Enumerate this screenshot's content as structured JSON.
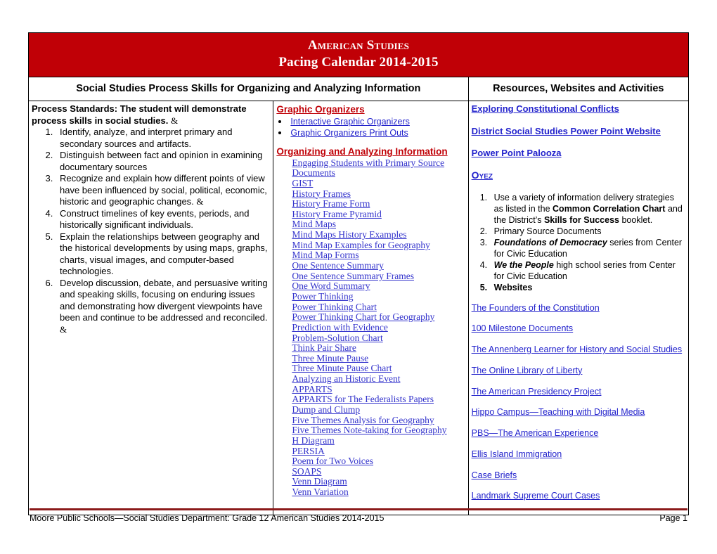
{
  "banner": {
    "title": "American Studies",
    "subtitle": "Pacing Calendar 2014-2015"
  },
  "columns": {
    "left_header": "Social Studies Process Skills for Organizing and Analyzing Information",
    "right_header": "Resources, Websites and Activities"
  },
  "left_column": {
    "intro_bold": "Process Standards: The student will demonstrate process skills in social studies.",
    "intro_amp": "&",
    "standards": [
      "Identify, analyze, and interpret primary and secondary sources and artifacts.",
      "Distinguish between fact and opinion in examining documentary sources",
      "Recognize and explain how different points of view have been influenced by social, political, economic, historic and geographic changes. &",
      "Construct timelines of key events, periods, and historically significant individuals.",
      "Explain the relationships between geography and the historical developments by using maps, graphs, charts, visual images, and computer-based technologies.",
      "Develop discussion, debate, and persuasive writing and speaking skills, focusing on enduring issues and demonstrating how divergent viewpoints have been and continue to be addressed and reconciled. &"
    ]
  },
  "middle_column": {
    "section1_heading": "Graphic Organizers",
    "section1_links": [
      "Interactive Graphic Organizers",
      "Graphic Organizers Print Outs"
    ],
    "section2_heading": "Organizing and Analyzing Information",
    "section2_links": [
      "Engaging Students with Primary Source Documents",
      "GIST",
      "History Frames",
      "History Frame Form",
      "History Frame Pyramid",
      "Mind Maps",
      "Mind Maps History Examples",
      "Mind Map Examples for Geography",
      "Mind Map Forms",
      "One Sentence Summary",
      "One Sentence Summary Frames",
      "One Word Summary",
      "Power Thinking",
      "Power Thinking Chart",
      "Power Thinking Chart for Geography",
      "Prediction with Evidence",
      "Problem-Solution Chart",
      "Think Pair Share",
      "Three Minute Pause",
      "Three Minute Pause Chart",
      "Analyzing an Historic Event",
      "APPARTS",
      "APPARTS for The Federalists Papers",
      "Dump and Clump",
      "Five Themes Analysis for Geography",
      "Five Themes Note-taking for Geography",
      "H Diagram",
      "PERSIA",
      "Poem for Two Voices",
      "SOAPS",
      "Venn Diagram",
      "Venn Variation"
    ]
  },
  "right_column": {
    "top_links": [
      {
        "label": "Exploring Constitutional Conflicts",
        "style": "normal"
      },
      {
        "label": "District Social Studies Power Point Website",
        "style": "normal"
      },
      {
        "label": "Power Point Palooza",
        "style": "normal"
      },
      {
        "label": "Oyez",
        "style": "small-caps"
      }
    ],
    "numbered_items": [
      {
        "parts": [
          {
            "text": "Use a variety of information delivery strategies as listed in the ",
            "fmt": "plain"
          },
          {
            "text": "Common Correlation Chart",
            "fmt": "bold"
          },
          {
            "text": " and the District’s ",
            "fmt": "plain"
          },
          {
            "text": "Skills for Success",
            "fmt": "bold"
          },
          {
            "text": " booklet.",
            "fmt": "plain"
          }
        ]
      },
      {
        "parts": [
          {
            "text": "Primary Source Documents",
            "fmt": "plain"
          }
        ]
      },
      {
        "parts": [
          {
            "text": "Foundations of Democracy",
            "fmt": "bold-italic"
          },
          {
            "text": "  series from Center for Civic Education",
            "fmt": "plain"
          }
        ]
      },
      {
        "parts": [
          {
            "text": "We the People",
            "fmt": "bold-italic"
          },
          {
            "text": "  high school series from Center for Civic Education",
            "fmt": "plain"
          }
        ]
      },
      {
        "bold": true,
        "parts": [
          {
            "text": "Websites",
            "fmt": "bold"
          }
        ]
      }
    ],
    "resource_links": [
      "The Founders of the Constitution",
      "100 Milestone Documents",
      "The Annenberg Learner for History and Social Studies",
      "The Online Library of Liberty",
      "The American Presidency Project",
      "Hippo Campus—Teaching with Digital Media",
      "PBS—The American Experience",
      "Ellis Island Immigration",
      "Case Briefs",
      "Landmark Supreme Court Cases"
    ]
  },
  "footer": {
    "left": "Moore Public Schools—Social Studies Department: Grade 12 American Studies 2014-2015",
    "right": "Page 1"
  },
  "colors": {
    "banner_red": "#c00006",
    "heading_red": "#c00006",
    "link_blue": "#2222cc",
    "footer_rule": "#8b1a1a"
  }
}
